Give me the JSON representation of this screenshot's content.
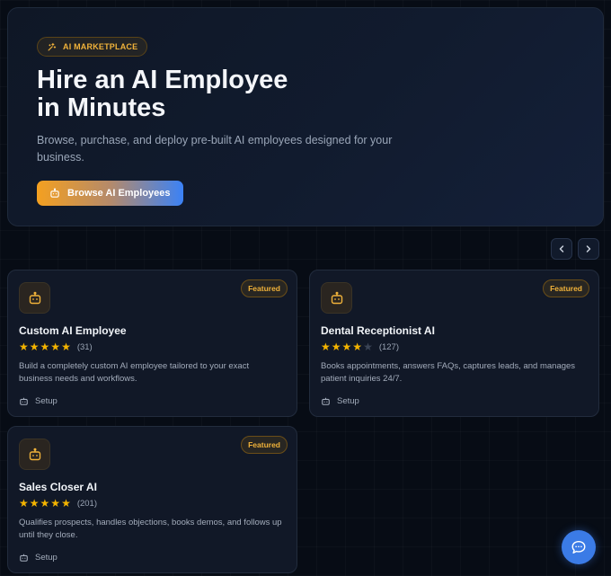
{
  "hero": {
    "badge": "AI MARKETPLACE",
    "badge_icon": "sparkle-icon",
    "title": "Hire an AI Employee in Minutes",
    "subtitle": "Browse, purchase, and deploy pre-built AI employees designed for your business.",
    "cta_label": "Browse AI Employees",
    "cta_icon": "robot-icon"
  },
  "carousel": {
    "prev_icon": "chevron-left-icon",
    "next_icon": "chevron-right-icon"
  },
  "cards": [
    {
      "title": "Custom AI Employee",
      "badge": "Featured",
      "rating": 5,
      "rating_count": "(31)",
      "description": "Build a completely custom AI employee tailored to your exact business needs and workflows.",
      "footer": "Setup"
    },
    {
      "title": "Dental Receptionist AI",
      "badge": "Featured",
      "rating": 4,
      "rating_count": "(127)",
      "description": "Books appointments, answers FAQs, captures leads, and manages patient inquiries 24/7.",
      "footer": "Setup"
    },
    {
      "title": "Sales Closer AI",
      "badge": "Featured",
      "rating": 5,
      "rating_count": "(201)",
      "description": "Qualifies prospects, handles objections, books demos, and follows up until they close.",
      "footer": "Setup"
    }
  ],
  "chat": {
    "icon": "chat-bubble-icon"
  },
  "colors": {
    "background": "#070c15",
    "accent_gold": "#f0b23a",
    "accent_blue": "#3b82f6",
    "star": "#f4b400"
  }
}
